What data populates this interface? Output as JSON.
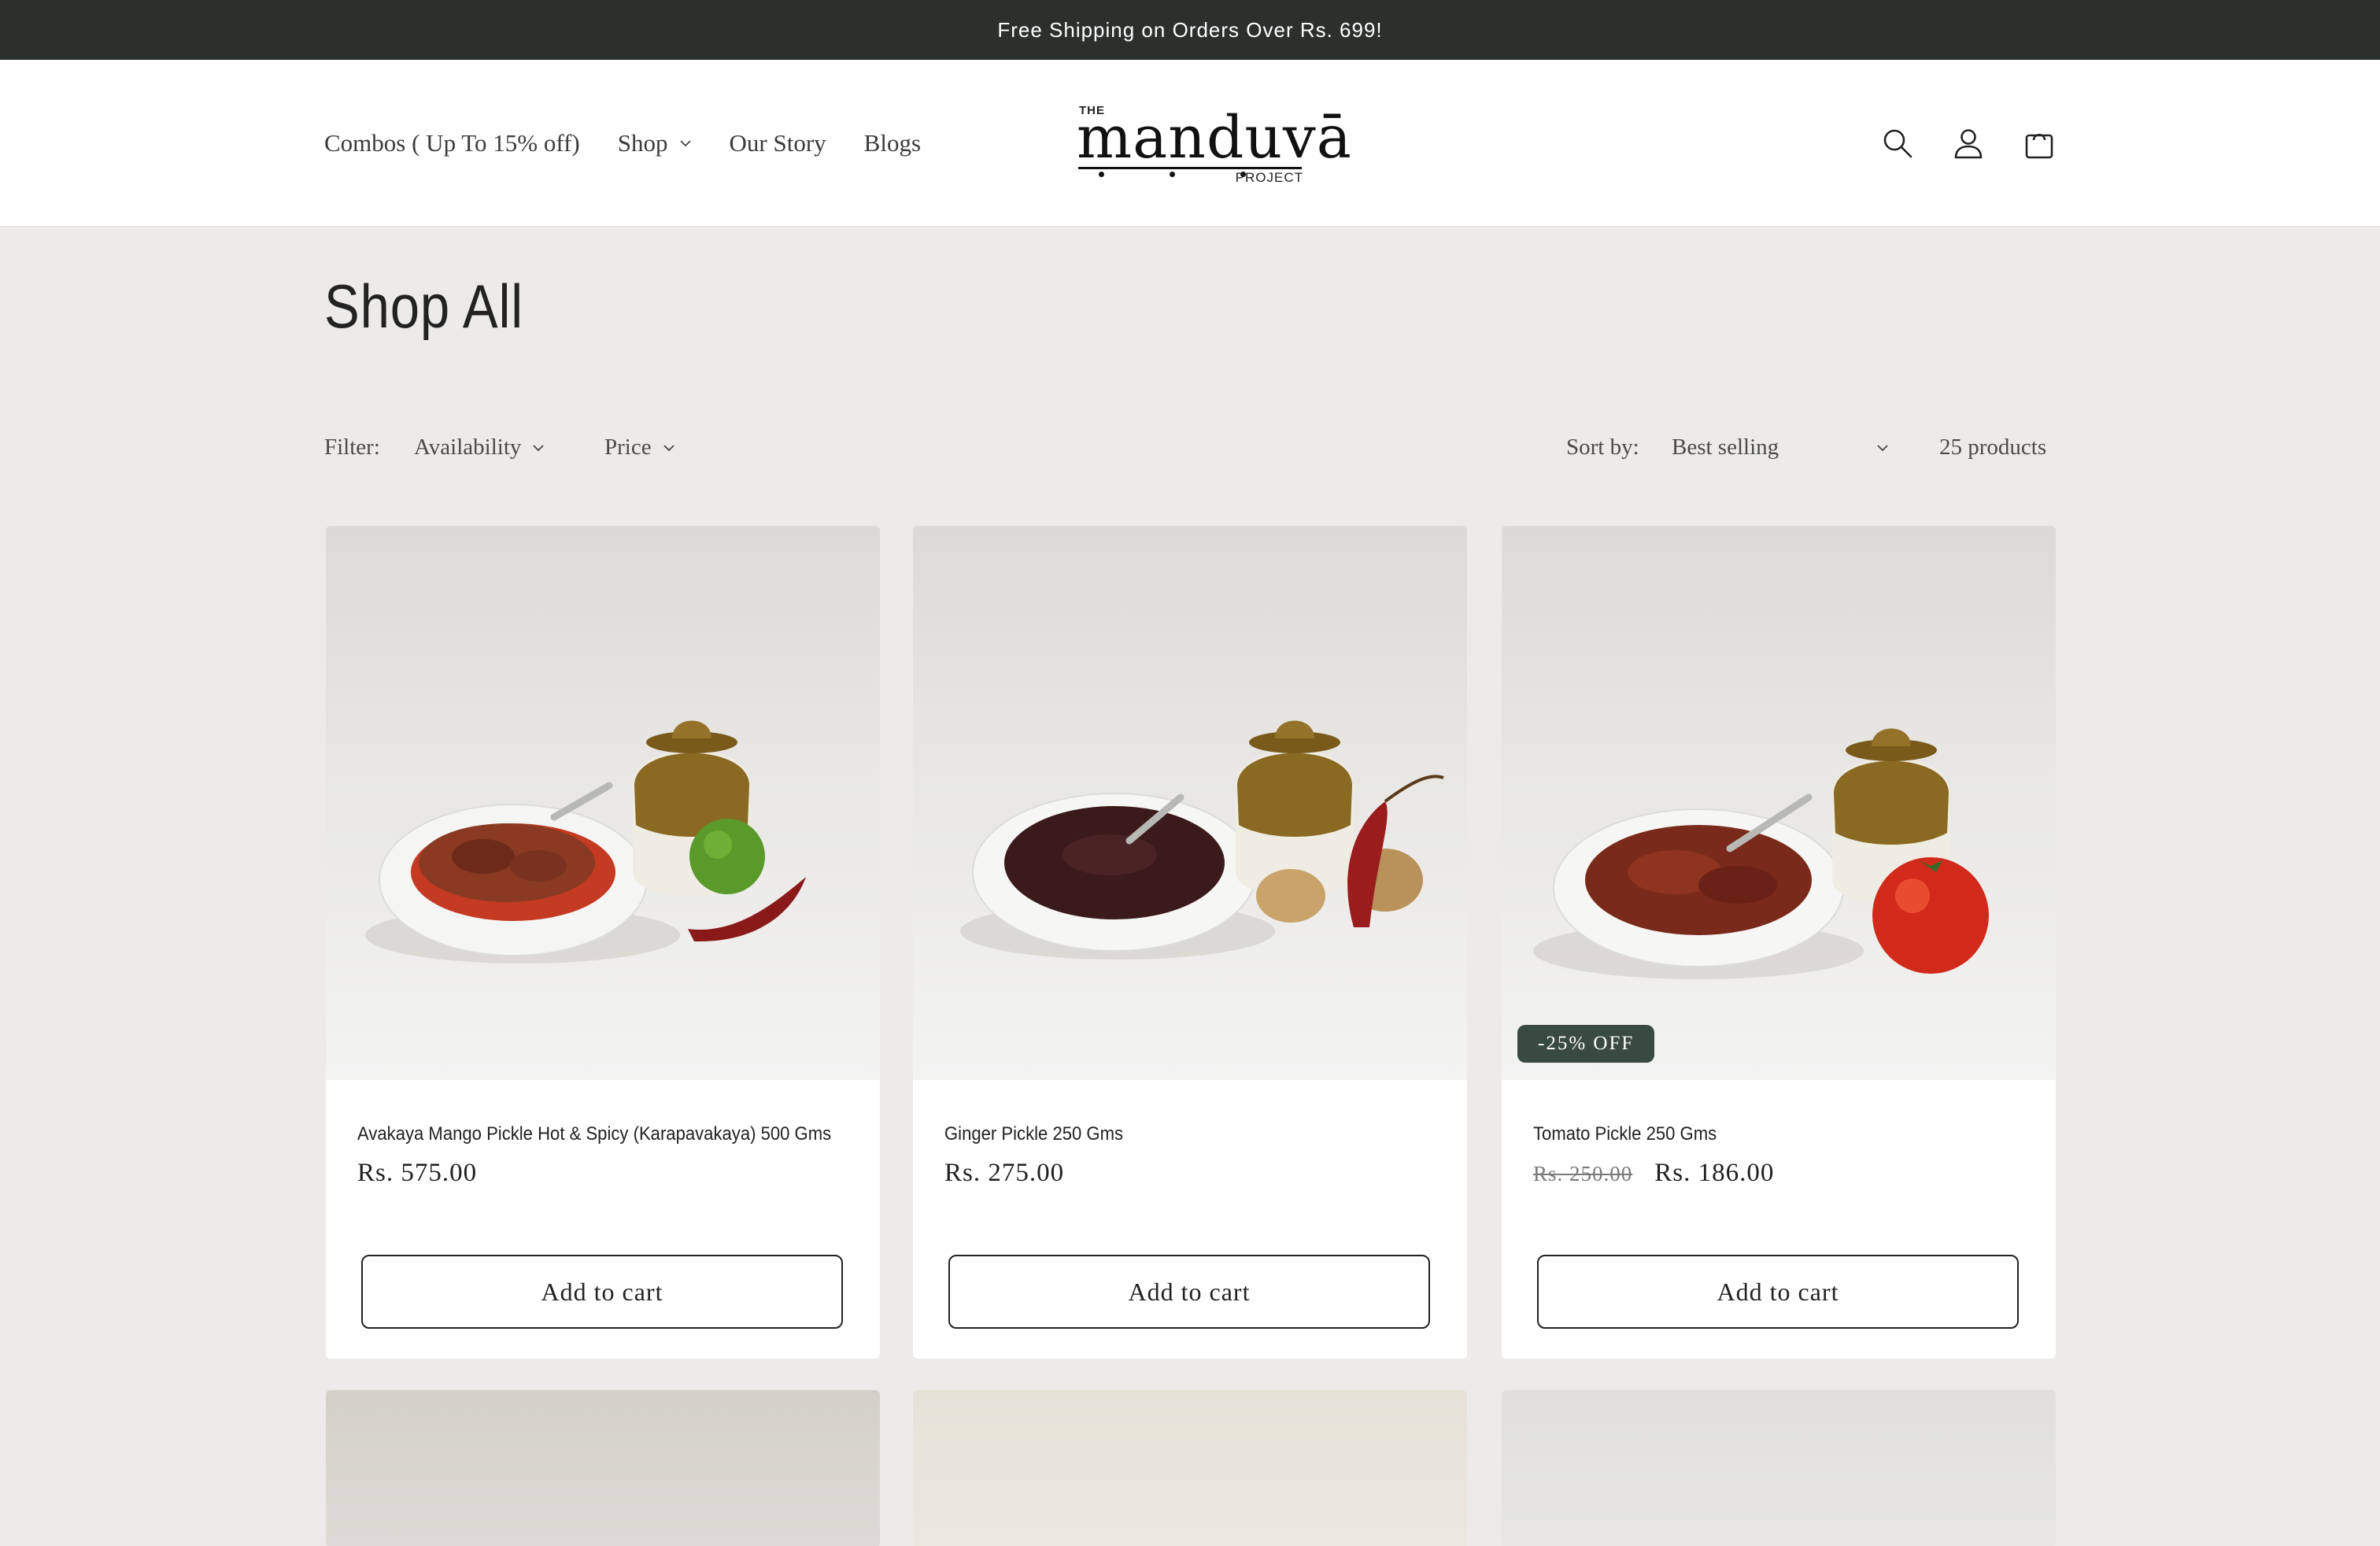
{
  "announcement": "Free Shipping on Orders Over Rs. 699!",
  "nav": {
    "items": [
      {
        "label": "Combos ( Up To 15% off)",
        "dropdown": false
      },
      {
        "label": "Shop",
        "dropdown": true
      },
      {
        "label": "Our Story",
        "dropdown": false
      },
      {
        "label": "Blogs",
        "dropdown": false
      }
    ]
  },
  "logo": {
    "the": "THE",
    "brand": "manduvā",
    "project": "PROJECT"
  },
  "header_icons": [
    "search-icon",
    "account-icon",
    "cart-icon"
  ],
  "page_title": "Shop All",
  "filters": {
    "label": "Filter:",
    "availability": "Availability",
    "price": "Price",
    "sort_label": "Sort by:",
    "sort_value": "Best selling",
    "count": "25 products"
  },
  "products": [
    {
      "name": "Avakaya Mango Pickle Hot & Spicy (Karapavakaya) 500 Gms",
      "price": "Rs. 575.00",
      "old_price": "",
      "badge": "",
      "button": "Add to cart",
      "garnish": "mango"
    },
    {
      "name": "Ginger Pickle 250 Gms",
      "price": "Rs. 275.00",
      "old_price": "",
      "badge": "",
      "button": "Add to cart",
      "garnish": "ginger"
    },
    {
      "name": "Tomato Pickle 250 Gms",
      "price": "Rs. 186.00",
      "old_price": "Rs. 250.00",
      "badge": "-25% OFF",
      "button": "Add to cart",
      "garnish": "tomato"
    }
  ],
  "colors": {
    "announce_bg": "#2b302d",
    "page_bg": "#edebe9",
    "badge_bg": "#394a40"
  }
}
